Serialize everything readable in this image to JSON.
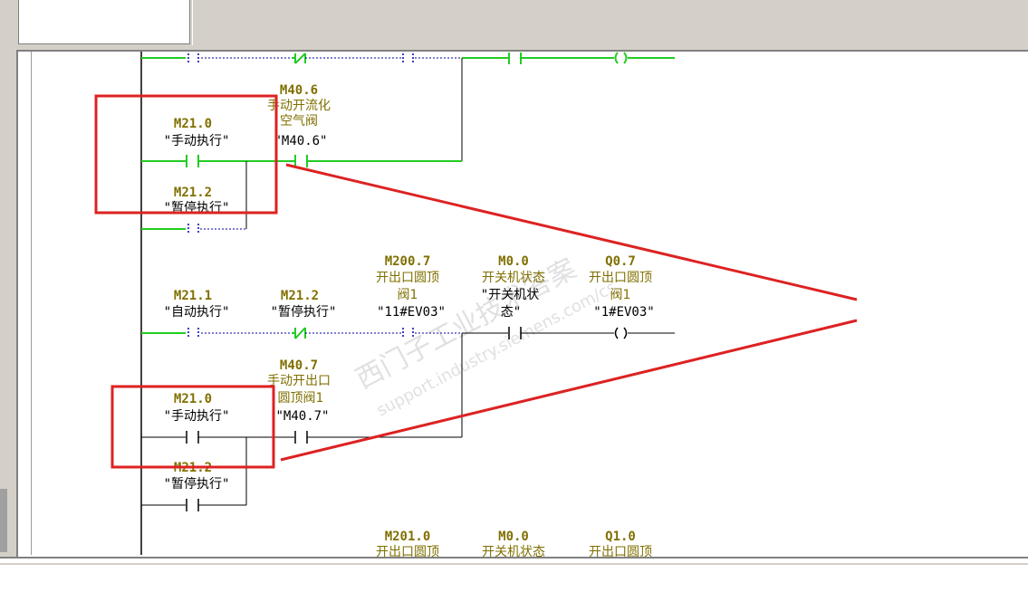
{
  "contacts": [
    {
      "addr": "M40.6",
      "comment1": "手动开流化",
      "comment2": "空气阀",
      "symbol": "\"M40.6\""
    },
    {
      "addr": "M21.0",
      "comment1": "",
      "comment2": "",
      "symbol": "\"手动执行\""
    },
    {
      "addr": "M21.2",
      "comment1": "",
      "comment2": "",
      "symbol": "\"暂停执行\""
    },
    {
      "addr": "M21.1",
      "comment1": "",
      "comment2": "",
      "symbol": "\"自动执行\""
    },
    {
      "addr": "M21.2",
      "comment1": "",
      "comment2": "",
      "symbol": "\"暂停执行\""
    },
    {
      "addr": "M200.7",
      "comment1": "开出口圆顶",
      "comment2": "阀1",
      "symbol": "\"11#EV03\""
    },
    {
      "addr": "M0.0",
      "comment1": "开关机状态",
      "comment2": "",
      "symbol": "\"开关机状"
    },
    {
      "addr": "Q0.7",
      "comment1": "开出口圆顶",
      "comment2": "阀1",
      "symbol": "\"1#EV03\""
    },
    {
      "addr": "M40.7",
      "comment1": "手动开出口",
      "comment2": "圆顶阀1",
      "symbol": "\"M40.7\""
    },
    {
      "addr": "M21.0",
      "comment1": "",
      "comment2": "",
      "symbol": "\"手动执行\""
    },
    {
      "addr": "M21.2",
      "comment1": "",
      "comment2": "",
      "symbol": "\"暂停执行\""
    },
    {
      "addr": "M201.0",
      "comment1": "开出口圆顶",
      "comment2": "",
      "symbol": ""
    },
    {
      "addr": "M0.0",
      "comment1": "开关机状态",
      "comment2": "",
      "symbol": ""
    },
    {
      "addr": "Q1.0",
      "comment1": "开出口圆顶",
      "comment2": "",
      "symbol": ""
    }
  ],
  "symbol_suffix_m00": "态\"",
  "watermark": {
    "cn": "西门子工业技术答案",
    "url": "support.industry.siemens.com/cs"
  },
  "colors": {
    "energized": "#22cc22",
    "annotation": "#dd2222",
    "address": "#807000",
    "wire": "#000000",
    "dashed": "#0000aa"
  }
}
